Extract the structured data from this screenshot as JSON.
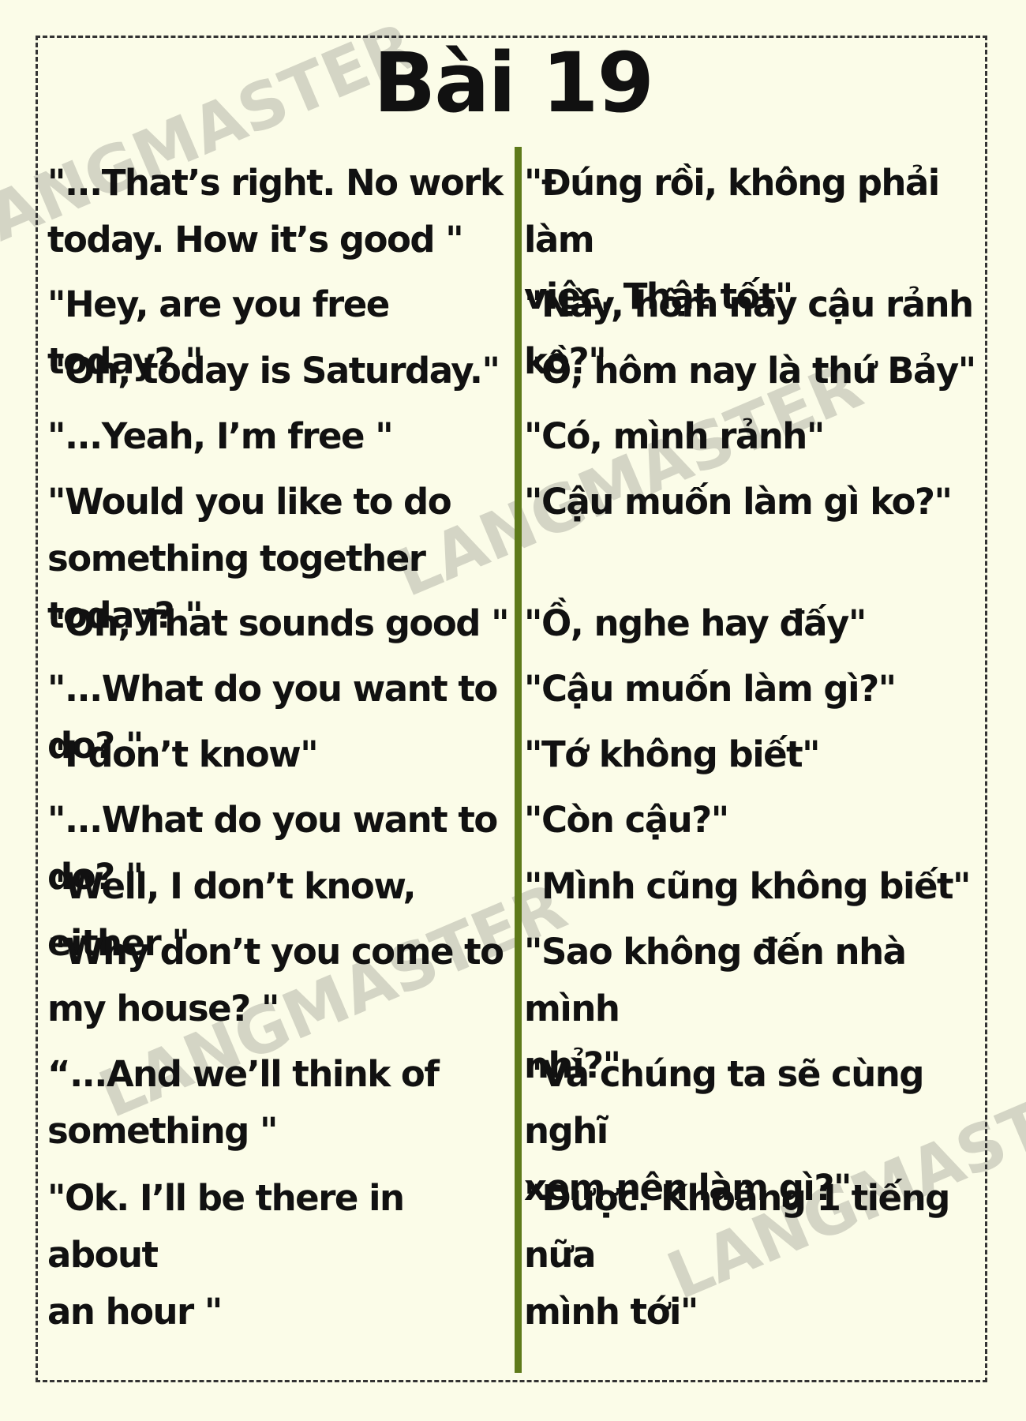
{
  "title": "Bài 19",
  "watermark": "LANGMASTER",
  "colors": {
    "background": "#fbfce8",
    "divider": "#5e7a1a",
    "text": "#111111"
  },
  "rows": [
    {
      "en": "\"...That’s right. No work\ntoday. How it’s good \"",
      "vi": "\"Đúng rồi, không phải làm\nviệc. Thật tốt\""
    },
    {
      "en": "\"Hey, are you free today? \"",
      "vi": "\"Này, hôm nay cậu rảnh ko?\""
    },
    {
      "en": "\"Oh, today is Saturday.\"",
      "vi": "\"Ồ, hôm nay là thứ Bảy\""
    },
    {
      "en": "\"...Yeah, I’m free \"",
      "vi": "\"Có, mình rảnh\""
    },
    {
      "en": "\"Would you like to do\nsomething together today? \"",
      "vi": "\"Cậu muốn làm gì ko?\""
    },
    {
      "en": "\"Oh, That sounds good \"",
      "vi": "\"Ồ, nghe hay đấy\""
    },
    {
      "en": "\"...What do you want to do? \"",
      "vi": "\"Cậu muốn làm gì?\""
    },
    {
      "en": "\"I don’t know\"",
      "vi": "\"Tớ không biết\""
    },
    {
      "en": "\"...What do you want to do? \"",
      "vi": "\"Còn cậu?\""
    },
    {
      "en": "\"Well, I don’t know, either \"",
      "vi": "\"Mình cũng không biết\""
    },
    {
      "en": "\"Why don’t you come to\nmy house? \"",
      "vi": "\"Sao không đến nhà mình\nnhỉ?\""
    },
    {
      "en": "“...And we’ll think of\nsomething \"",
      "vi": "\"Và chúng ta sẽ cùng nghĩ\nxem nên làm gì?\""
    },
    {
      "en": "\"Ok. I’ll be there in about\nan hour \"",
      "vi": "\"Được. Khoảng 1 tiếng nữa\nmình tới\""
    }
  ]
}
